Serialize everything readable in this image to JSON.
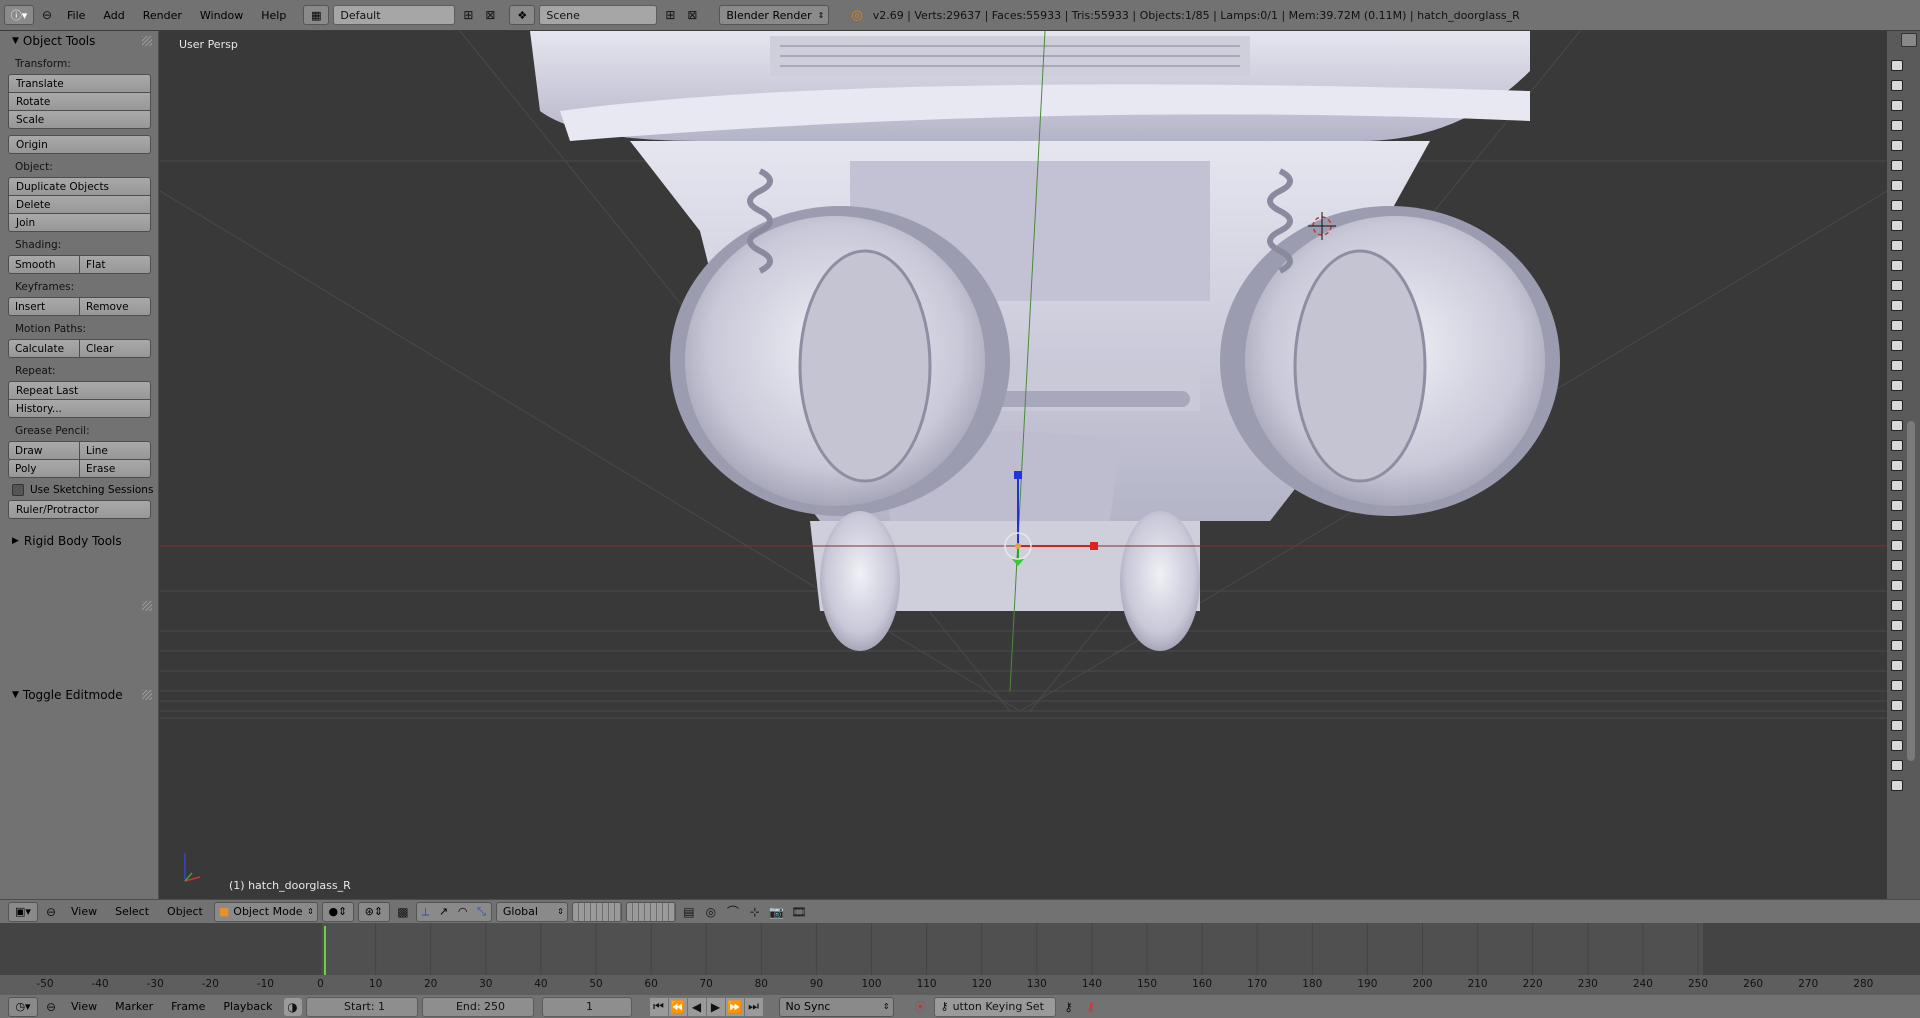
{
  "topbar": {
    "menus": [
      "File",
      "Add",
      "Render",
      "Window",
      "Help"
    ],
    "screen_layout": "Default",
    "scene": "Scene",
    "render_engine": "Blender Render",
    "stats": "v2.69 | Verts:29637 | Faces:55933 | Tris:55933 | Objects:1/85 | Lamps:0/1 | Mem:39.72M (0.11M) | hatch_doorglass_R"
  },
  "toolshelf": {
    "title": "Object Tools",
    "transform_label": "Transform:",
    "translate": "Translate",
    "rotate": "Rotate",
    "scale": "Scale",
    "origin": "Origin",
    "object_label": "Object:",
    "duplicate": "Duplicate Objects",
    "delete": "Delete",
    "join": "Join",
    "shading_label": "Shading:",
    "smooth": "Smooth",
    "flat": "Flat",
    "keyframes_label": "Keyframes:",
    "insert": "Insert",
    "remove": "Remove",
    "motion_label": "Motion Paths:",
    "calculate": "Calculate",
    "clear": "Clear",
    "repeat_label": "Repeat:",
    "repeat_last": "Repeat Last",
    "history": "History...",
    "grease_label": "Grease Pencil:",
    "draw": "Draw",
    "line": "Line",
    "poly": "Poly",
    "erase": "Erase",
    "use_sketching": "Use Sketching Sessions",
    "ruler": "Ruler/Protractor",
    "rigid_body": "Rigid Body Tools",
    "toggle_editmode": "Toggle Editmode"
  },
  "viewport": {
    "view_name": "User Persp",
    "object_info": "(1) hatch_doorglass_R"
  },
  "vp_header": {
    "menus": [
      "View",
      "Select",
      "Object"
    ],
    "mode": "Object Mode",
    "orientation": "Global"
  },
  "timeline": {
    "ticks": [
      "-50",
      "-40",
      "-30",
      "-20",
      "-10",
      "0",
      "10",
      "20",
      "30",
      "40",
      "50",
      "60",
      "70",
      "80",
      "90",
      "100",
      "110",
      "120",
      "130",
      "140",
      "150",
      "160",
      "170",
      "180",
      "190",
      "200",
      "210",
      "220",
      "230",
      "240",
      "250",
      "260",
      "270",
      "280"
    ],
    "menus": [
      "View",
      "Marker",
      "Frame",
      "Playback"
    ],
    "start": "Start: 1",
    "end": "End: 250",
    "current": "1",
    "sync": "No Sync",
    "keying_set": "utton Keying Set"
  }
}
